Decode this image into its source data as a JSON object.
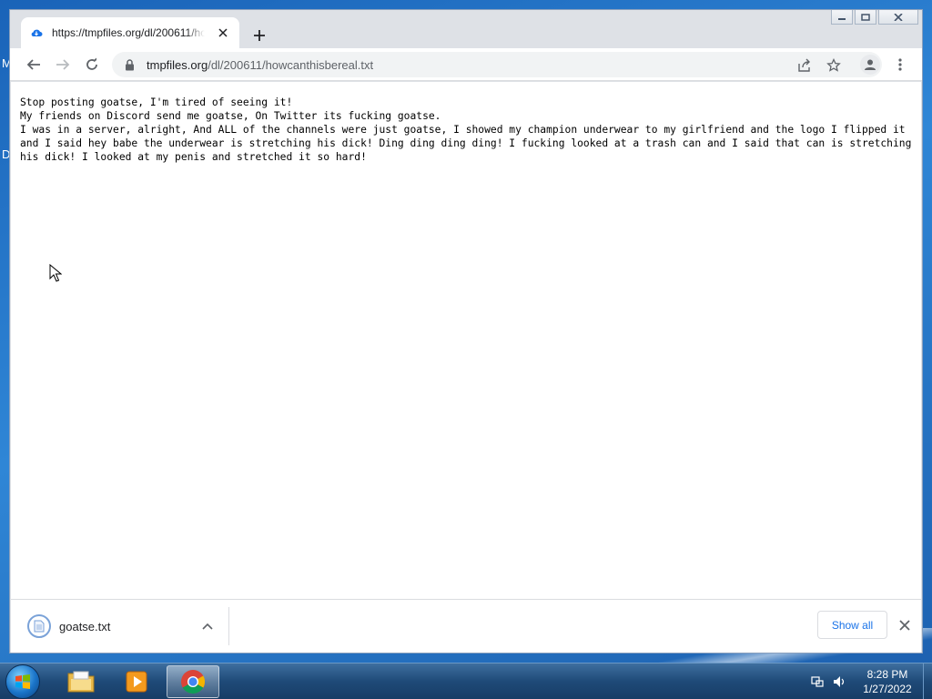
{
  "desktop": {
    "peek_top": "M",
    "peek_bottom": "D"
  },
  "browser": {
    "tab_title": "https://tmpfiles.org/dl/200611/howcanthisbereal.txt",
    "url_host": "tmpfiles.org",
    "url_path": "/dl/200611/howcanthisbereal.txt"
  },
  "document": {
    "text": "Stop posting goatse, I'm tired of seeing it!\nMy friends on Discord send me goatse, On Twitter its fucking goatse.\nI was in a server, alright, And ALL of the channels were just goatse, I showed my champion underwear to my girlfriend and the logo I flipped it and I said hey babe the underwear is stretching his dick! Ding ding ding ding! I fucking looked at a trash can and I said that can is stretching his dick! I looked at my penis and stretched it so hard!"
  },
  "downloads": {
    "file_name": "goatse.txt",
    "show_all_label": "Show all"
  },
  "taskbar": {
    "time": "8:28 PM",
    "date": "1/27/2022"
  },
  "colors": {
    "accent": "#1a73e8",
    "desktop": "#2f86d6",
    "taskbar": "#1f4a78"
  }
}
